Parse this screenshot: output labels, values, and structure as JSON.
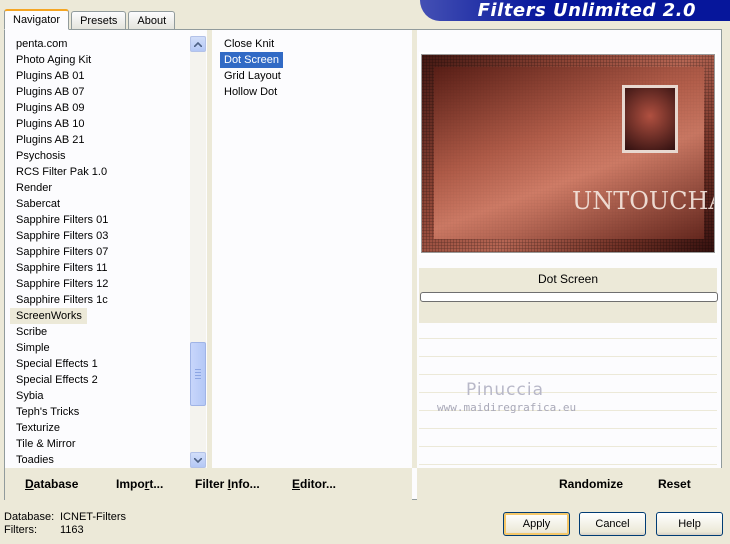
{
  "tabs": [
    "Navigator",
    "Presets",
    "About"
  ],
  "banner_title": "Filters Unlimited 2.0",
  "categories": [
    "penta.com",
    "Photo Aging Kit",
    "Plugins AB 01",
    "Plugins AB 07",
    "Plugins AB 09",
    "Plugins AB 10",
    "Plugins AB 21",
    "Psychosis",
    "RCS Filter Pak 1.0",
    "Render",
    "Sabercat",
    "Sapphire Filters 01",
    "Sapphire Filters 03",
    "Sapphire Filters 07",
    "Sapphire Filters 11",
    "Sapphire Filters 12",
    "Sapphire Filters 1c",
    "ScreenWorks",
    "Scribe",
    "Simple",
    "Special Effects 1",
    "Special Effects 2",
    "Sybia",
    "Teph's Tricks",
    "Texturize",
    "Tile & Mirror",
    "Toadies"
  ],
  "selected_category": "ScreenWorks",
  "filters": [
    "Close Knit",
    "Dot Screen",
    "Grid Layout",
    "Hollow Dot"
  ],
  "selected_filter": "Dot Screen",
  "preview_text": "UNTOUCHABLE",
  "current_filter_name": "Dot Screen",
  "watermark": {
    "name": "Pinuccia",
    "url": "www.maidiregrafica.eu"
  },
  "bottom_buttons_left": {
    "database": {
      "label": "Database",
      "u": "D",
      "rest": "atabase"
    },
    "import": {
      "label": "Import...",
      "pre": "Impo",
      "u": "r",
      "rest": "t..."
    },
    "filter_info": {
      "label": "Filter Info...",
      "pre": "Filter ",
      "u": "I",
      "rest": "nfo..."
    },
    "editor": {
      "label": "Editor...",
      "u": "E",
      "rest": "ditor..."
    }
  },
  "bottom_buttons_right": {
    "randomize": "Randomize",
    "reset": "Reset"
  },
  "status": {
    "database_label": "Database:",
    "database_value": "ICNET-Filters",
    "filters_label": "Filters:",
    "filters_value": "1163"
  },
  "dialog_buttons": {
    "apply": "Apply",
    "cancel": "Cancel",
    "help": "Help"
  },
  "colors": {
    "banner": "#06169b",
    "selection": "#316ac5",
    "background": "#ece9d8"
  }
}
